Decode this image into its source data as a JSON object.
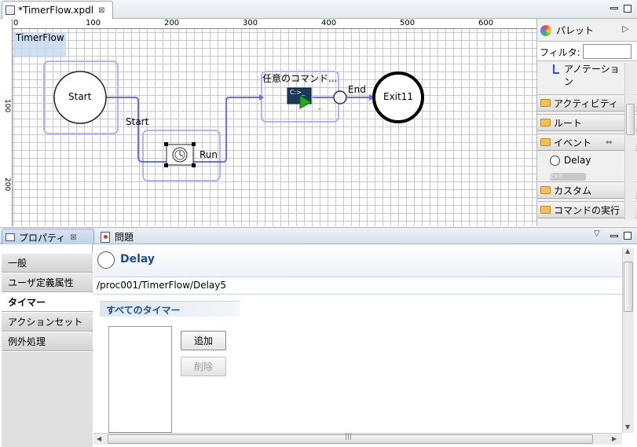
{
  "editor": {
    "tab_label": "*TimerFlow.xpdl",
    "close_glyph": "⊠"
  },
  "ruler": {
    "h_ticks": [
      "0",
      "100",
      "200",
      "300",
      "400",
      "500",
      "600"
    ],
    "v_ticks": [
      "100",
      "200"
    ]
  },
  "diagram": {
    "pool_label": "TimerFlow",
    "start_label": "Start",
    "start_transition_label": "Start",
    "run_transition_label": "Run",
    "command_label": "任意のコマンド...",
    "command_sub": "-",
    "end_transition_label": "End",
    "exit_label": "Exit11",
    "cmd_icon_text": "C:>_"
  },
  "palette": {
    "title": "パレット",
    "filter_label": "フィルタ:",
    "filter_value": "",
    "annotation_label": "アノテーション",
    "activity": "アクティビティ",
    "route": "ルート",
    "event": "イベント",
    "delay": "Delay",
    "exit_faint": "Exit",
    "custom": "カスタム",
    "command": "コマンドの実行"
  },
  "bottom_tabs": {
    "properties": "プロパティ",
    "problems": "問題"
  },
  "properties": {
    "header_title": "Delay",
    "path": "/proc001/TimerFlow/Delay5",
    "tabs": [
      "一般",
      "ユーザ定義属性",
      "タイマー",
      "アクションセット",
      "例外処理"
    ],
    "section_title": "すべてのタイマー",
    "add_button": "追加",
    "delete_button": "削除"
  },
  "colors": {
    "accent": "#6e6ee6",
    "selection": "#c8d8f0",
    "title_blue": "#1d4e8a"
  }
}
